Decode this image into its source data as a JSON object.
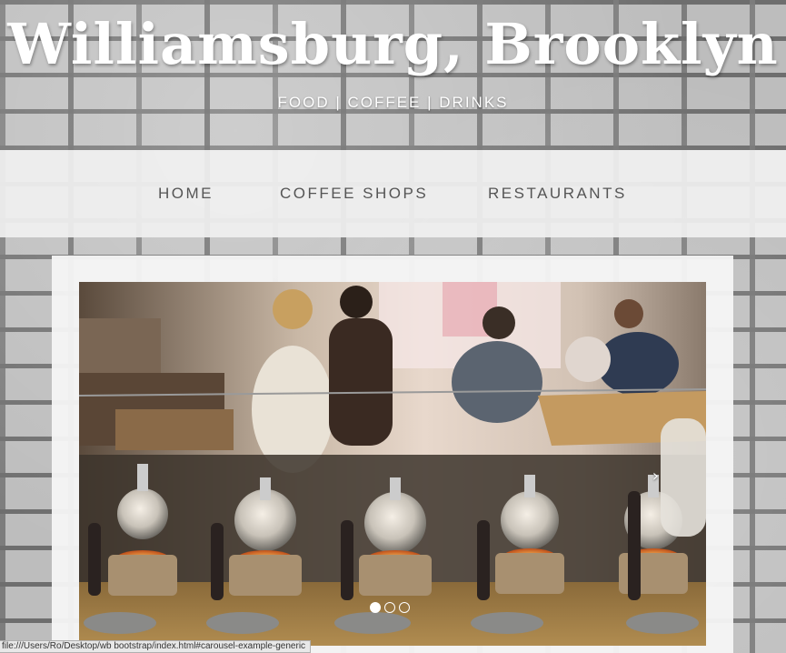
{
  "header": {
    "title": "Williamsburg, Brooklyn",
    "tagline": "FOOD | COFFEE | DRINKS"
  },
  "nav": {
    "items": [
      {
        "label": "HOME"
      },
      {
        "label": "COFFEE SHOPS"
      },
      {
        "label": "RESTAURANTS"
      }
    ]
  },
  "carousel": {
    "next_icon": "chevron-right-icon",
    "next_glyph": "›",
    "slide_count": 3,
    "active_index": 0,
    "photo_subject": "coffee-siphon-bar-photo"
  },
  "status": {
    "url": "file:///Users/Ro/Desktop/wb bootstrap/index.html#carousel-example-generic"
  },
  "colors": {
    "nav_text": "#555555",
    "title": "#ffffff",
    "nav_bg": "#f0f0f0"
  }
}
